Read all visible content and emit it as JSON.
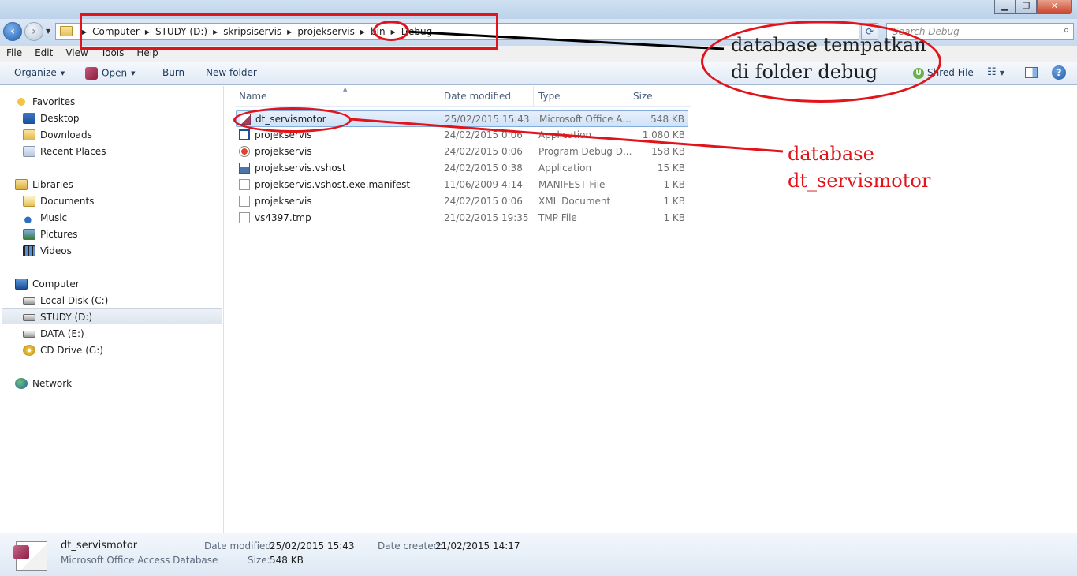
{
  "window": {
    "title_text": "",
    "controls": {
      "minimize": "▁",
      "maximize": "❐",
      "close": "✕"
    }
  },
  "address": {
    "crumbs": [
      "Computer",
      "STUDY (D:)",
      "skripsiservis",
      "projekservis",
      "bin",
      "Debug"
    ],
    "search_placeholder": "Search Debug",
    "refresh_icon": "⟳",
    "search_icon": "⌕"
  },
  "menu": [
    "File",
    "Edit",
    "View",
    "Tools",
    "Help"
  ],
  "toolbar": {
    "organize": "Organize",
    "open": "Open",
    "burn": "Burn",
    "new_folder": "New folder",
    "shared_file": "Shred File",
    "views_icon": "☷",
    "help": "?"
  },
  "nav": {
    "favorites": {
      "label": "Favorites",
      "items": [
        "Desktop",
        "Downloads",
        "Recent Places"
      ]
    },
    "libraries": {
      "label": "Libraries",
      "items": [
        "Documents",
        "Music",
        "Pictures",
        "Videos"
      ]
    },
    "computer": {
      "label": "Computer",
      "items": [
        "Local Disk (C:)",
        "STUDY (D:)",
        "DATA (E:)",
        "CD Drive (G:)"
      ]
    },
    "network": {
      "label": "Network"
    }
  },
  "columns": {
    "name": "Name",
    "date": "Date modified",
    "type": "Type",
    "size": "Size"
  },
  "files": [
    {
      "name": "dt_servismotor",
      "date": "25/02/2015 15:43",
      "type": "Microsoft Office A...",
      "size": "548 KB",
      "icon": "access-db-icon"
    },
    {
      "name": "projekservis",
      "date": "24/02/2015 0:06",
      "type": "Application",
      "size": "1.080 KB",
      "icon": "application-icon"
    },
    {
      "name": "projekservis",
      "date": "24/02/2015 0:06",
      "type": "Program Debug D...",
      "size": "158 KB",
      "icon": "pdb-icon"
    },
    {
      "name": "projekservis.vshost",
      "date": "24/02/2015 0:38",
      "type": "Application",
      "size": "15 KB",
      "icon": "vshost-app-icon"
    },
    {
      "name": "projekservis.vshost.exe.manifest",
      "date": "11/06/2009 4:14",
      "type": "MANIFEST File",
      "size": "1 KB",
      "icon": "file-icon"
    },
    {
      "name": "projekservis",
      "date": "24/02/2015 0:06",
      "type": "XML Document",
      "size": "1 KB",
      "icon": "xml-file-icon"
    },
    {
      "name": "vs4397.tmp",
      "date": "21/02/2015 19:35",
      "type": "TMP File",
      "size": "1 KB",
      "icon": "file-icon"
    }
  ],
  "details": {
    "name": "dt_servismotor",
    "type": "Microsoft Office Access Database",
    "date_modified_label": "Date modified:",
    "date_modified": "25/02/2015 15:43",
    "date_created_label": "Date created:",
    "date_created": "21/02/2015 14:17",
    "size_label": "Size:",
    "size": "548 KB"
  },
  "annotations": {
    "folder_note_line1": "database tempatkan",
    "folder_note_line2": "di folder debug",
    "db_note_line1": "database",
    "db_note_line2": "dt_servismotor",
    "note_color_black": "#000000",
    "note_color_red": "#e0141a"
  }
}
